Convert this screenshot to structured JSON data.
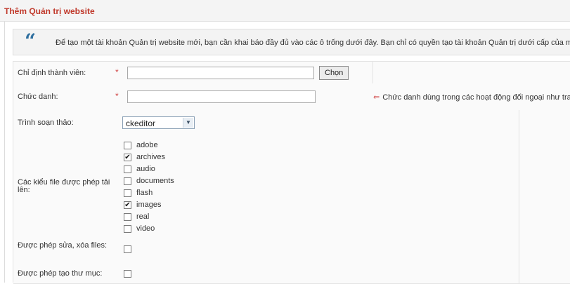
{
  "page_title": "Thêm Quản trị website",
  "note": {
    "icon": "quote-icon",
    "text": "Để tạo một tài khoản Quản trị website mới, bạn cần khai báo đầy đủ vào các ô trống dưới đây. Bạn chỉ có quyền tạo tài khoản Quản trị dưới cấp của mình"
  },
  "form": {
    "member": {
      "label": "Chỉ định thành viên:",
      "required_mark": "*",
      "value": "",
      "button_label": "Chọn"
    },
    "position": {
      "label": "Chức danh:",
      "required_mark": "*",
      "value": "",
      "hint_arrow": "⇐",
      "hint": "Chức danh dùng trong các hoạt động đối ngoại như tra"
    },
    "editor": {
      "label": "Trình soạn thảo:",
      "selected": "ckeditor"
    },
    "file_types": {
      "label": "Các kiểu file được phép tải lên:",
      "options": [
        {
          "label": "adobe",
          "checked": false
        },
        {
          "label": "archives",
          "checked": true
        },
        {
          "label": "audio",
          "checked": false
        },
        {
          "label": "documents",
          "checked": false
        },
        {
          "label": "flash",
          "checked": false
        },
        {
          "label": "images",
          "checked": true
        },
        {
          "label": "real",
          "checked": false
        },
        {
          "label": "video",
          "checked": false
        }
      ]
    },
    "edit_delete_files": {
      "label": "Được phép sửa, xóa files:",
      "checked": false
    },
    "create_folder": {
      "label": "Được phép tạo thư mục:",
      "checked": false
    }
  }
}
